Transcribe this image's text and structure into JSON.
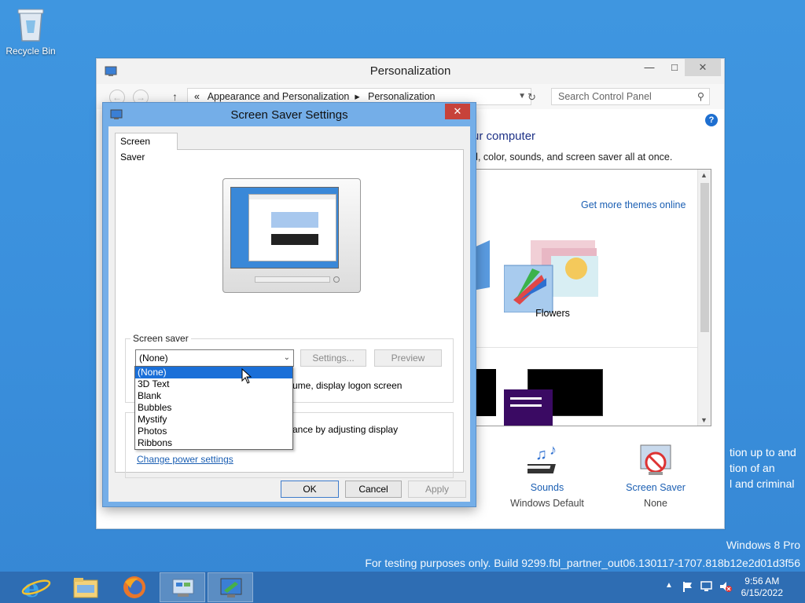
{
  "desktop": {
    "recycle_bin_label": "Recycle Bin",
    "watermark_line1": "Windows 8 Pro",
    "watermark_line2": "For testing purposes only. Build 9299.fbl_partner_out06.130117-1707.818b12e2d01d3f56",
    "bleed_text": [
      "tion up to and",
      "tion of an",
      "l and criminal"
    ]
  },
  "personalization": {
    "title": "Personalization",
    "breadcrumb": [
      "«",
      "Appearance and Personalization",
      "Personalization"
    ],
    "search_placeholder": "Search Control Panel",
    "heading_partial": "ur computer",
    "desc_partial": "d, color, sounds, and screen saver all at once.",
    "get_more_themes": "Get more themes online",
    "theme_label": "Flowers",
    "bottom_items": [
      {
        "name": "Sounds",
        "value": "Windows Default"
      },
      {
        "name": "Screen Saver",
        "value": "None"
      }
    ]
  },
  "dialog": {
    "title": "Screen Saver Settings",
    "tab_label": "Screen Saver",
    "screensaver_group_label": "Screen saver",
    "selected": "(None)",
    "options": [
      "(None)",
      "3D Text",
      "Blank",
      "Bubbles",
      "Mystify",
      "Photos",
      "Ribbons"
    ],
    "settings_btn": "Settings...",
    "preview_btn": "Preview",
    "resume_text_partial": "ume, display logon screen",
    "power_text_partial": "ance by adjusting display",
    "change_power_link": "Change power settings",
    "ok_btn": "OK",
    "cancel_btn": "Cancel",
    "apply_btn": "Apply"
  },
  "taskbar": {
    "time": "9:56 AM",
    "date": "6/15/2022"
  }
}
